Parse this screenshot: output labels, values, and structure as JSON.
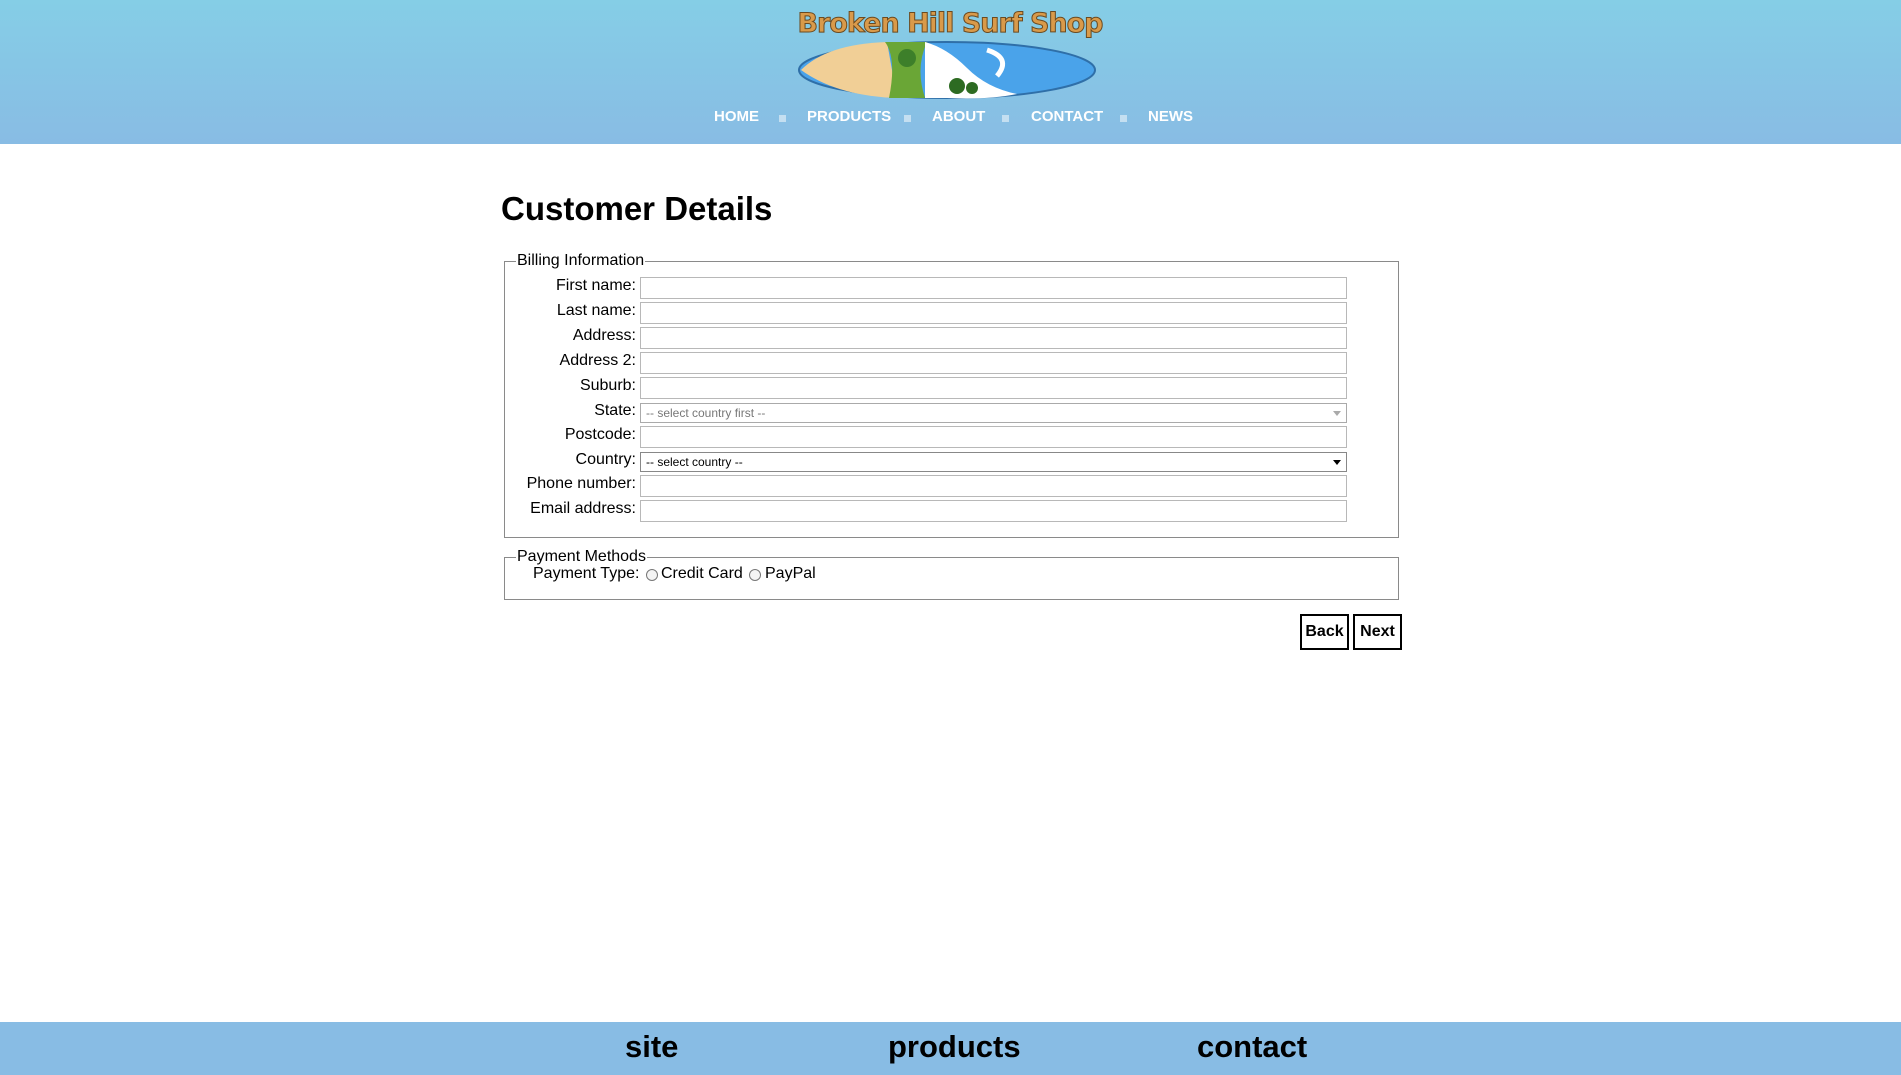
{
  "header": {
    "logo_text": "Broken Hill Surf Shop",
    "nav": [
      "HOME",
      "PRODUCTS",
      "ABOUT",
      "CONTACT",
      "NEWS"
    ]
  },
  "main": {
    "title": "Customer Details",
    "billing": {
      "legend": "Billing Information",
      "fields": [
        {
          "label": "First name:",
          "value": ""
        },
        {
          "label": "Last name:",
          "value": ""
        },
        {
          "label": "Address:",
          "value": ""
        },
        {
          "label": "Address 2:",
          "value": ""
        },
        {
          "label": "Suburb:",
          "value": ""
        },
        {
          "label": "State:",
          "selected": "-- select country first --"
        },
        {
          "label": "Postcode:",
          "value": ""
        },
        {
          "label": "Country:",
          "selected": "-- select country --"
        },
        {
          "label": "Phone number:",
          "value": ""
        },
        {
          "label": "Email address:",
          "value": ""
        }
      ]
    },
    "payment": {
      "legend": "Payment Methods",
      "label": "Payment Type:",
      "options": [
        "Credit Card",
        "PayPal"
      ]
    },
    "buttons": {
      "back": "Back",
      "next": "Next"
    }
  },
  "footer": {
    "links": [
      "site",
      "products",
      "contact"
    ]
  },
  "colors": {
    "header_top": "#85cee6",
    "header_bottom": "#88bce4",
    "footer": "#88bce4",
    "logo_text": "#d99a4a"
  }
}
